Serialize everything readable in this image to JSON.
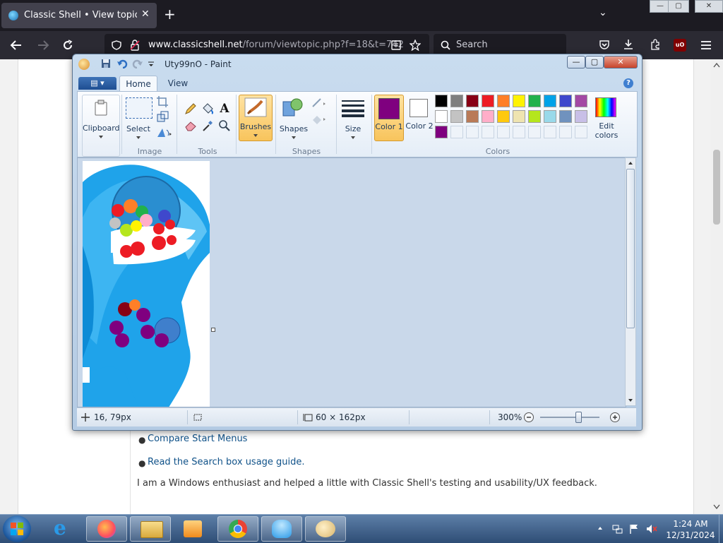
{
  "browser": {
    "tab_title": "Classic Shell • View topic - Windows",
    "tab_close": "✕",
    "new_tab": "+",
    "tab_list": "⌄",
    "url_host": "www.classicshell.net",
    "url_path": "/forum/viewtopic.php?f=18&t=742",
    "search_placeholder": "Search",
    "back_win_controls": [
      "—",
      "▢",
      "✕"
    ]
  },
  "webpage": {
    "links": [
      "Compare Start Menus",
      "Read the Search box usage guide."
    ],
    "paragraph": "I am a Windows enthusiast and helped a little with Classic Shell's testing and usability/UX feedback."
  },
  "paint": {
    "title": "Uty99nO - Paint",
    "window_controls": [
      "—",
      "▢",
      "✕"
    ],
    "file_menu": "▤ ▾",
    "tabs": [
      "Home",
      "View"
    ],
    "help": "?",
    "groups": {
      "clipboard": "Clipboard",
      "image": "Image",
      "tools": "Tools",
      "shapes": "Shapes",
      "colors": "Colors"
    },
    "buttons": {
      "select": "Select",
      "brushes": "Brushes",
      "shapes": "Shapes",
      "size": "Size",
      "color1": "Color 1",
      "color2": "Color 2",
      "edit_colors": "Edit colors"
    },
    "color1_value": "#7f007f",
    "color2_value": "#ffffff",
    "palette_row1": [
      "#000000",
      "#7f7f7f",
      "#880015",
      "#ed1c24",
      "#ff7f27",
      "#fff200",
      "#22b14c",
      "#00a2e8",
      "#3f48cc",
      "#a349a4"
    ],
    "palette_row2": [
      "#ffffff",
      "#c3c3c3",
      "#b97a57",
      "#ffaec9",
      "#ffc90e",
      "#efe4b0",
      "#b5e61d",
      "#99d9ea",
      "#7092be",
      "#c8bfe7"
    ],
    "palette_row3": [
      "#7f007f",
      "",
      "",
      "",
      "",
      "",
      "",
      "",
      "",
      ""
    ],
    "status": {
      "cursor_pos": "16, 79px",
      "image_size": "60 × 162px",
      "zoom": "300%"
    }
  },
  "taskbar": {
    "time": "1:24 AM",
    "date": "12/31/2024"
  }
}
